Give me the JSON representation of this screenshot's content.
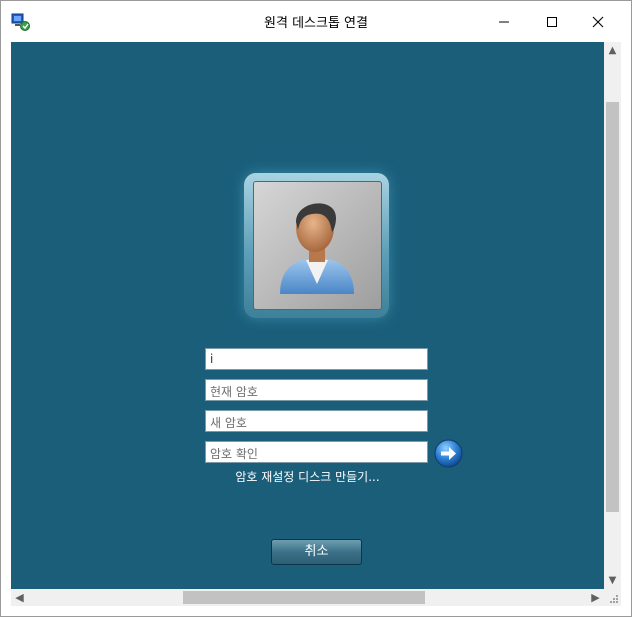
{
  "window": {
    "title": "원격 데스크톱 연결",
    "controls": {
      "minimize": "minimize-icon",
      "maximize": "maximize-icon",
      "close": "close-icon"
    }
  },
  "colors": {
    "background": "#1a5e7a",
    "field_border": "#7a9aa8"
  },
  "login": {
    "avatar_icon": "user-avatar-icon",
    "username_value": "i",
    "current_password_placeholder": "현재 암호",
    "new_password_placeholder": "새 암호",
    "confirm_password_placeholder": "암호 확인",
    "submit_icon": "arrow-right-icon",
    "reset_disk_link": "암호 재설정 디스크 만들기...",
    "cancel_label": "취소"
  },
  "scrollbars": {
    "up": "▲",
    "down": "▼",
    "left": "◀",
    "right": "▶"
  }
}
